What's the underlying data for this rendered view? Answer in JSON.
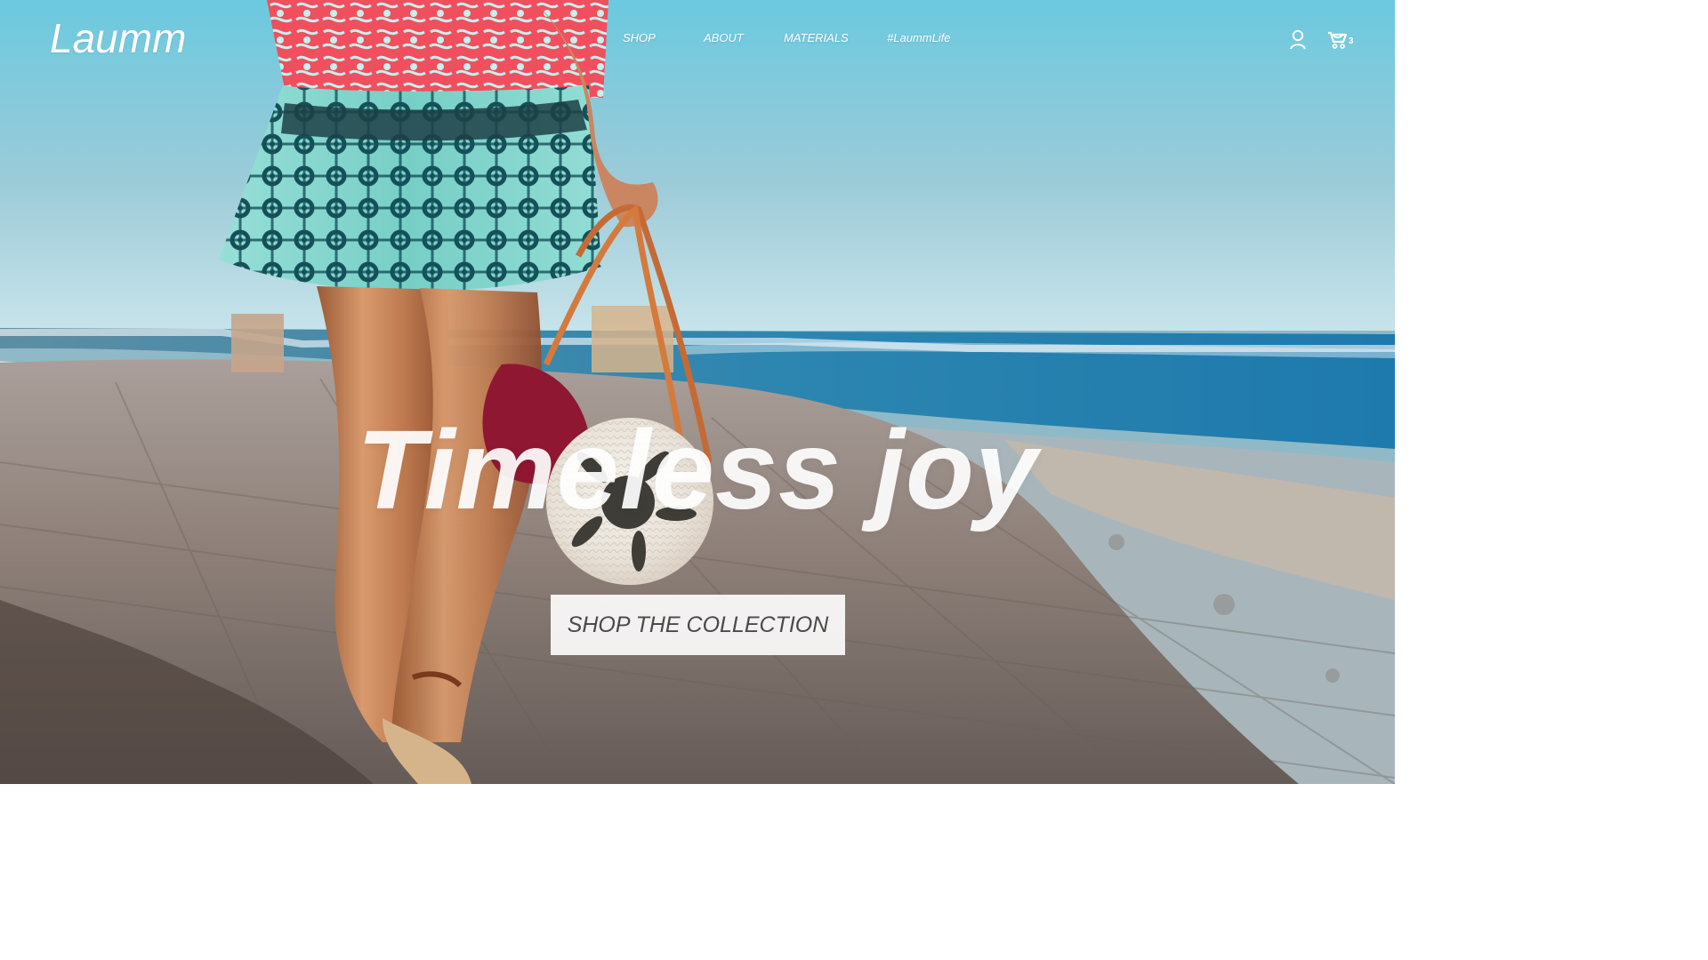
{
  "brand": {
    "name": "Laumm"
  },
  "navigation": {
    "items": [
      {
        "label": "SHOP"
      },
      {
        "label": "ABOUT"
      },
      {
        "label": "MATERIALS"
      },
      {
        "label": "#LaummLife"
      }
    ]
  },
  "header_actions": {
    "account_icon": "user-icon",
    "cart_icon": "shopping-cart-icon",
    "cart_count": "3"
  },
  "hero": {
    "headline": "Timeless joy",
    "cta_label": "SHOP THE COLLECTION"
  },
  "colors": {
    "header_text": "#ffffff",
    "headline_text": "#f7f7f7",
    "button_background": "#ffffff",
    "button_text": "#4a4a4a"
  }
}
